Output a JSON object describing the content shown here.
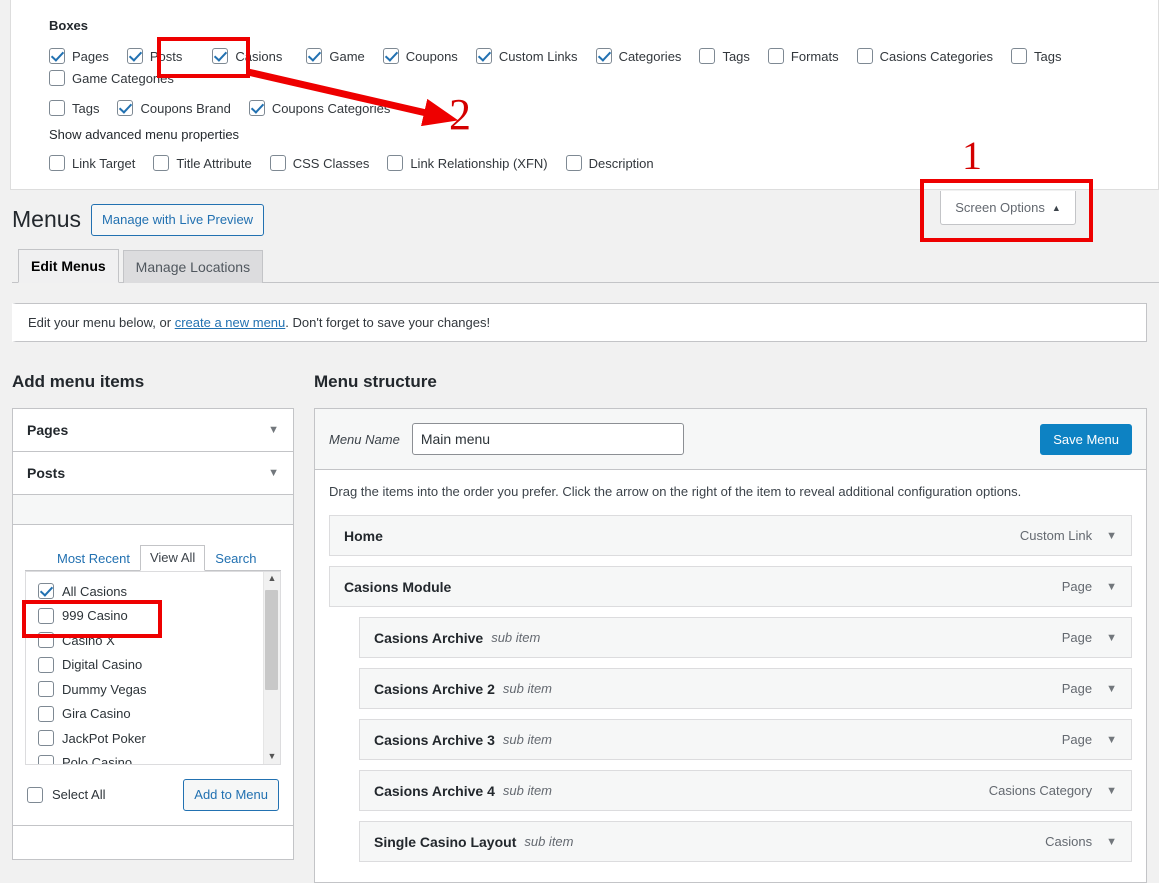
{
  "screen_options": {
    "boxes_heading": "Boxes",
    "boxes": [
      {
        "label": "Pages",
        "checked": true
      },
      {
        "label": "Posts",
        "checked": true
      },
      {
        "label": "Casions",
        "checked": true
      },
      {
        "label": "Game",
        "checked": true
      },
      {
        "label": "Coupons",
        "checked": true
      },
      {
        "label": "Custom Links",
        "checked": true
      },
      {
        "label": "Categories",
        "checked": true
      },
      {
        "label": "Tags",
        "checked": false
      },
      {
        "label": "Formats",
        "checked": false
      },
      {
        "label": "Casions Categories",
        "checked": false
      },
      {
        "label": "Tags",
        "checked": false
      },
      {
        "label": "Game Categories",
        "checked": false
      }
    ],
    "boxes_row2": [
      {
        "label": "Tags",
        "checked": false
      },
      {
        "label": "Coupons Brand",
        "checked": true
      },
      {
        "label": "Coupons Categories",
        "checked": true
      }
    ],
    "advanced_heading": "Show advanced menu properties",
    "advanced": [
      {
        "label": "Link Target",
        "checked": false
      },
      {
        "label": "Title Attribute",
        "checked": false
      },
      {
        "label": "CSS Classes",
        "checked": false
      },
      {
        "label": "Link Relationship (XFN)",
        "checked": false
      },
      {
        "label": "Description",
        "checked": false
      }
    ],
    "toggle_label": "Screen Options",
    "toggle_arrow": "▲"
  },
  "header": {
    "title": "Menus",
    "live_preview_button": "Manage with Live Preview",
    "tabs": [
      {
        "label": "Edit Menus",
        "active": true
      },
      {
        "label": "Manage Locations",
        "active": false
      }
    ]
  },
  "notice": {
    "prefix": "Edit your menu below, or ",
    "link": "create a new menu",
    "suffix": ". Don't forget to save your changes!"
  },
  "add_menu_items": {
    "title": "Add menu items",
    "accordions": [
      {
        "label": "Pages",
        "caret": "▼"
      },
      {
        "label": "Posts",
        "caret": "▼"
      }
    ],
    "tabs": [
      {
        "label": "Most Recent",
        "active": false
      },
      {
        "label": "View All",
        "active": true
      },
      {
        "label": "Search",
        "active": false
      }
    ],
    "items": [
      {
        "label": "All Casions",
        "checked": true
      },
      {
        "label": "999 Casino",
        "checked": false
      },
      {
        "label": "Casino X",
        "checked": false
      },
      {
        "label": "Digital Casino",
        "checked": false
      },
      {
        "label": "Dummy Vegas",
        "checked": false
      },
      {
        "label": "Gira Casino",
        "checked": false
      },
      {
        "label": "JackPot Poker",
        "checked": false
      },
      {
        "label": "Polo Casino",
        "checked": false
      }
    ],
    "select_all_label": "Select All",
    "add_to_menu_label": "Add to Menu",
    "scroll_up_arrow": "︿",
    "scroll_down_arrow": "﹀"
  },
  "menu_structure": {
    "title": "Menu structure",
    "menu_name_label": "Menu Name",
    "menu_name_value": "Main menu",
    "save_label": "Save Menu",
    "drag_hint": "Drag the items into the order you prefer. Click the arrow on the right of the item to reveal additional configuration options.",
    "items": [
      {
        "title": "Home",
        "sub": "",
        "type": "Custom Link",
        "depth": 0,
        "caret": "▼"
      },
      {
        "title": "Casions Module",
        "sub": "",
        "type": "Page",
        "depth": 0,
        "caret": "▼"
      },
      {
        "title": "Casions Archive",
        "sub": "sub item",
        "type": "Page",
        "depth": 1,
        "caret": "▼"
      },
      {
        "title": "Casions Archive 2",
        "sub": "sub item",
        "type": "Page",
        "depth": 1,
        "caret": "▼"
      },
      {
        "title": "Casions Archive 3",
        "sub": "sub item",
        "type": "Page",
        "depth": 1,
        "caret": "▼"
      },
      {
        "title": "Casions Archive 4",
        "sub": "sub item",
        "type": "Casions Category",
        "depth": 1,
        "caret": "▼"
      },
      {
        "title": "Single Casino Layout",
        "sub": "sub item",
        "type": "Casions",
        "depth": 1,
        "caret": "▼"
      }
    ]
  },
  "annotations": {
    "color": "#ee0000",
    "number_one": "1",
    "number_two": "2"
  }
}
